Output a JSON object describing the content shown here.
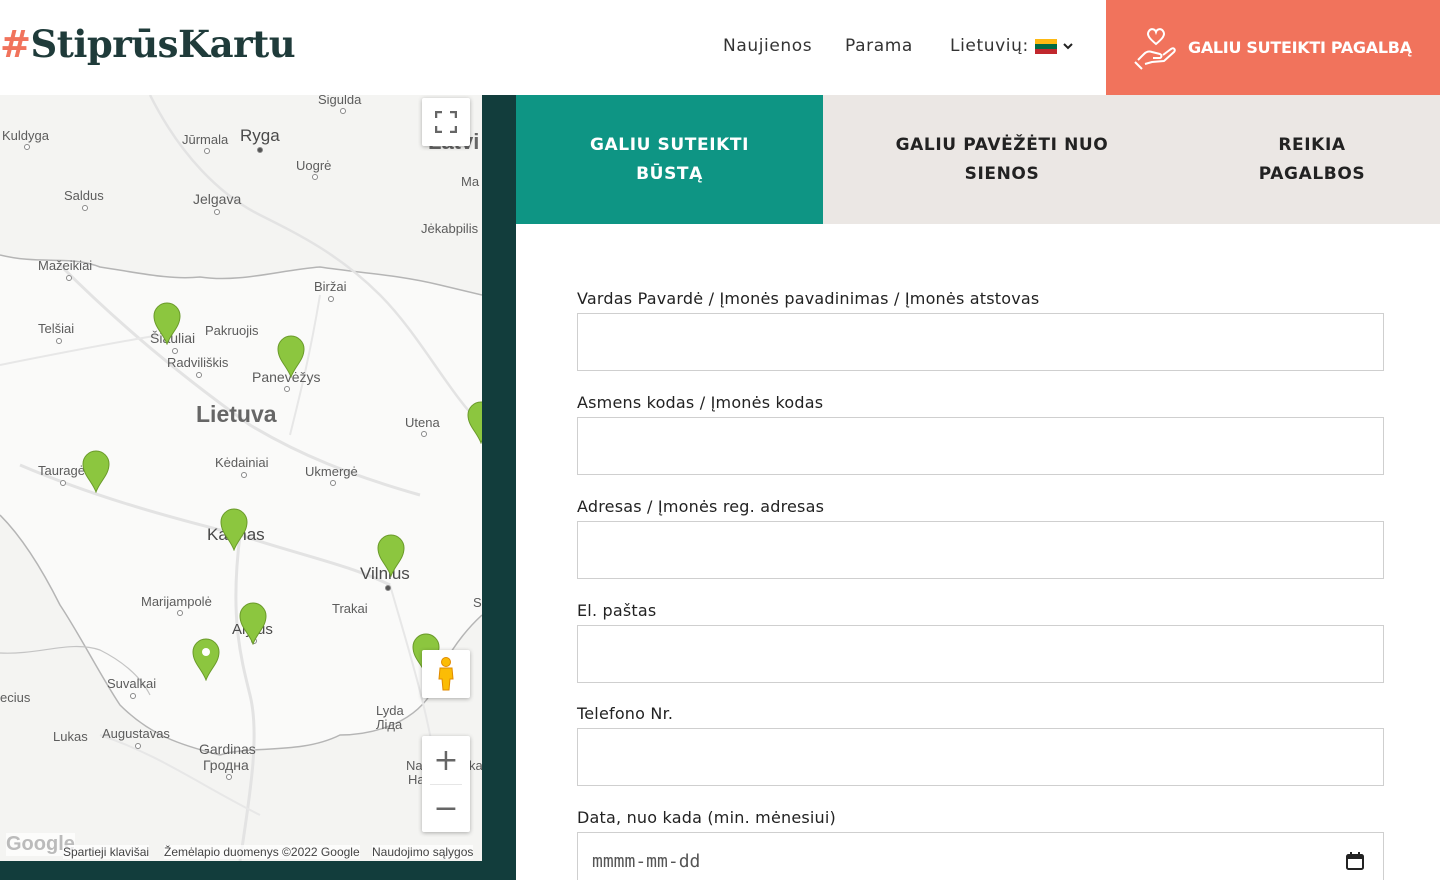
{
  "header": {
    "logo_hash": "#",
    "logo_text": "StiprūsKartu",
    "nav": {
      "news": "Naujienos",
      "support": "Parama",
      "language": "Lietuvių:"
    },
    "cta_label": "GALIU SUTEIKTI PAGALBĄ",
    "flag_colors": [
      "#fdb913",
      "#006a44",
      "#c1272d"
    ],
    "icons": {
      "cta": "hand-heart-icon",
      "chevron": "chevron-down-icon",
      "flag": "lithuania-flag-icon"
    }
  },
  "map": {
    "country_label": "Lietuva",
    "cities": {
      "sigulda": "Sigulda",
      "kuldyga": "Kuldyga",
      "jurmala": "Jūrmala",
      "ryga": "Ryga",
      "latvia": "Latvi",
      "ogre": "Uogrė",
      "ma": "Ma",
      "saldus": "Saldus",
      "jelgava": "Jelgava",
      "jekabpilis": "Jėkabpilis",
      "mazeikiai": "Mažeikiai",
      "birzai": "Biržai",
      "telsiai": "Telšiai",
      "siauliai": "Šiauliai",
      "pakruojis": "Pakruojis",
      "radviliskis": "Radviliškis",
      "panevezys": "Panevėžys",
      "utena": "Utena",
      "taurage": "Tauragė",
      "kedainiai": "Kėdainiai",
      "ukmerge": "Ukmergė",
      "kaunas": "Kaunas",
      "vilnius": "Vilnius",
      "marijampole": "Marijampolė",
      "trakai": "Trakai",
      "alytus": "Alytus",
      "suvalkai": "Suvalkai",
      "ecius": "ecius",
      "lyda": "Lyda",
      "lida_ru": "Лiда",
      "lukas": "Lukas",
      "augustavas": "Augustavas",
      "gardinas": "Gardinas",
      "grodno_ru": "Гродна",
      "na": "Na",
      "ha": "Ha",
      "ka": "ka",
      "s": "S"
    },
    "attribution": {
      "logo": "Google",
      "shortcuts": "Spartieji klavišai",
      "map_data": "Žemėlapio duomenys ©2022 Google",
      "terms": "Naudojimo sąlygos"
    },
    "controls": {
      "zoom_in": "+",
      "zoom_out": "−"
    },
    "pin_color": "#8cc63f",
    "icons": {
      "fullscreen": "fullscreen-icon",
      "pegman": "street-view-pegman-icon",
      "pin": "map-pin-icon"
    }
  },
  "tabs": [
    {
      "label": "GALIU SUTEIKTI\nBŪSTĄ",
      "active": true
    },
    {
      "label": "GALIU PAVĖŽĖTI NUO\nSIENOS",
      "active": false
    },
    {
      "label": "REIKIA\nPAGALBOS",
      "active": false
    }
  ],
  "form": {
    "name_label": "Vardas Pavardė / Įmonės pavadinimas / Įmonės atstovas",
    "name_value": "",
    "code_label": "Asmens kodas / Įmonės kodas",
    "code_value": "",
    "address_label": "Adresas / Įmonės reg. adresas",
    "address_value": "",
    "email_label": "El. paštas",
    "email_value": "",
    "phone_label": "Telefono Nr.",
    "phone_value": "",
    "date_label": "Data, nuo kada (min. mėnesiui)",
    "date_placeholder": "mmmm-mm-dd",
    "icons": {
      "date": "calendar-icon"
    }
  },
  "colors": {
    "accent_coral": "#f1735c",
    "accent_teal": "#0e9584",
    "dark_teal": "#123d3c",
    "tab_bg": "#ebe7e4"
  }
}
